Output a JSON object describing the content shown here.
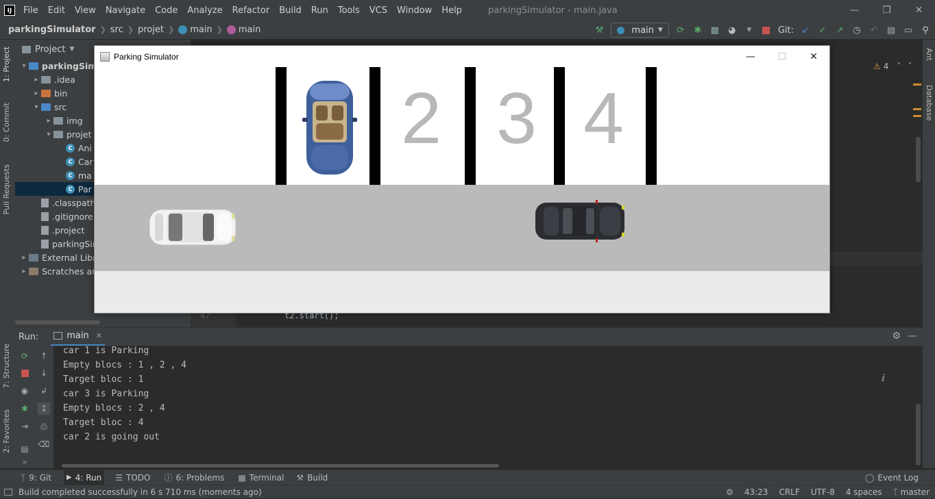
{
  "ide": {
    "app_logo": "IJ",
    "menu": [
      "File",
      "Edit",
      "View",
      "Navigate",
      "Code",
      "Analyze",
      "Refactor",
      "Build",
      "Run",
      "Tools",
      "VCS",
      "Window",
      "Help"
    ],
    "window_title": "parkingSimulator - main.java"
  },
  "navbar": {
    "project": "parkingSimulator",
    "crumbs": [
      "src",
      "projet",
      "main",
      "main"
    ],
    "run_config": "main",
    "git_label": "Git:"
  },
  "left_stripe": {
    "project_tab": "1: Project",
    "commit_tab": "0: Commit",
    "pull_requests_tab": "Pull Requests",
    "structure_tab": "7: Structure",
    "favorites_tab": "2: Favorites"
  },
  "right_stripe": {
    "ant_tab": "Ant",
    "database_tab": "Database"
  },
  "project_panel": {
    "title": "Project",
    "tree": [
      {
        "label": "parkingSimul",
        "indent": 0,
        "arrow": "▾",
        "icon": "folder-blue",
        "bold": true
      },
      {
        "label": ".idea",
        "indent": 1,
        "arrow": "▸",
        "icon": "folder-gray"
      },
      {
        "label": "bin",
        "indent": 1,
        "arrow": "▸",
        "icon": "folder-orange"
      },
      {
        "label": "src",
        "indent": 1,
        "arrow": "▾",
        "icon": "folder-blue"
      },
      {
        "label": "img",
        "indent": 2,
        "arrow": "▸",
        "icon": "folder-gray"
      },
      {
        "label": "projet",
        "indent": 2,
        "arrow": "▾",
        "icon": "folder-gray"
      },
      {
        "label": "Ani",
        "indent": 3,
        "arrow": "",
        "icon": "class"
      },
      {
        "label": "Car",
        "indent": 3,
        "arrow": "",
        "icon": "class"
      },
      {
        "label": "ma",
        "indent": 3,
        "arrow": "",
        "icon": "class"
      },
      {
        "label": "Par",
        "indent": 3,
        "arrow": "",
        "icon": "class",
        "selected": true
      },
      {
        "label": ".classpath",
        "indent": 1,
        "arrow": "",
        "icon": "file"
      },
      {
        "label": ".gitignore",
        "indent": 1,
        "arrow": "",
        "icon": "file"
      },
      {
        "label": ".project",
        "indent": 1,
        "arrow": "",
        "icon": "file"
      },
      {
        "label": "parkingSir",
        "indent": 1,
        "arrow": "",
        "icon": "file"
      },
      {
        "label": "External Libra",
        "indent": 0,
        "arrow": "▸",
        "icon": "library"
      },
      {
        "label": "Scratches anc",
        "indent": 0,
        "arrow": "▸",
        "icon": "scratch"
      }
    ]
  },
  "editor": {
    "visible_line_number": "47",
    "visible_code": "t2.start();",
    "warnings_count": "4"
  },
  "simulator": {
    "title": "Parking Simulator",
    "slot_numbers": [
      "2",
      "3",
      "4"
    ],
    "colors": {
      "road": "#bababa",
      "sidewalk": "#ebebeb",
      "pillar": "#000000",
      "slot_number": "#b8b8b8"
    }
  },
  "run_panel": {
    "label": "Run:",
    "tab": "main",
    "console": [
      "car 1 is Parking",
      "Empty blocs : 1 , 2 , 4",
      "Target bloc : 1",
      "car 3 is Parking",
      "Empty blocs : 2 , 4",
      "Target bloc : 4",
      "car 2 is going out"
    ]
  },
  "bottom_tabs": {
    "git": "9: Git",
    "run": "4: Run",
    "todo": "TODO",
    "problems": "6: Problems",
    "terminal": "Terminal",
    "build": "Build",
    "event_log": "Event Log"
  },
  "status": {
    "message": "Build completed successfully in 6 s 710 ms (moments ago)",
    "position": "43:23",
    "line_ending": "CRLF",
    "encoding": "UTF-8",
    "indent": "4 spaces",
    "branch": "master"
  }
}
